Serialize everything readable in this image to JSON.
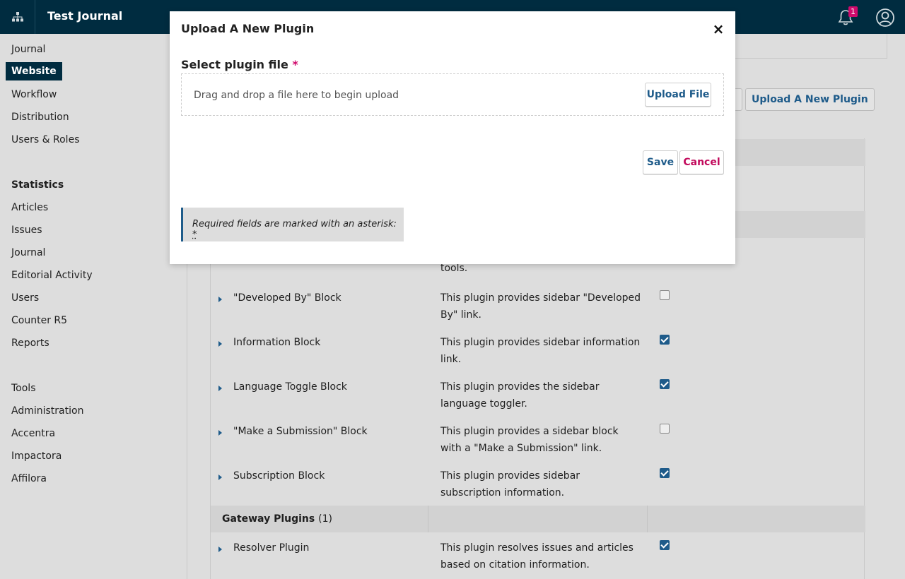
{
  "header": {
    "title": "Test Journal",
    "notification_count": "1",
    "brand_color": "#002c40",
    "accent_color": "#1e5b8a",
    "alert_color": "#d00a6c"
  },
  "sidebar": {
    "items": [
      {
        "label": "Journal"
      },
      {
        "label": "Website"
      },
      {
        "label": "Workflow"
      },
      {
        "label": "Distribution"
      },
      {
        "label": "Users & Roles"
      }
    ],
    "statistics_heading": "Statistics",
    "statistics_items": [
      {
        "label": "Articles"
      },
      {
        "label": "Issues"
      },
      {
        "label": "Journal"
      },
      {
        "label": "Editorial Activity"
      },
      {
        "label": "Users"
      },
      {
        "label": "Counter R5"
      },
      {
        "label": "Reports"
      }
    ],
    "tools_items": [
      {
        "label": "Tools"
      },
      {
        "label": "Administration"
      },
      {
        "label": "Accentra"
      },
      {
        "label": "Impactora"
      },
      {
        "label": "Affilora"
      }
    ]
  },
  "main": {
    "upload_button_label": "Upload A New Plugin",
    "partial_desc": "tools.",
    "plugins": [
      {
        "name": "\"Developed By\" Block",
        "desc": "This plugin provides sidebar \"Developed By\" link.",
        "enabled": false
      },
      {
        "name": "Information Block",
        "desc": "This plugin provides sidebar information link.",
        "enabled": true
      },
      {
        "name": "Language Toggle Block",
        "desc": "This plugin provides the sidebar language toggler.",
        "enabled": true
      },
      {
        "name": "\"Make a Submission\" Block",
        "desc": "This plugin provides a sidebar block with a \"Make a Submission\" link.",
        "enabled": false
      },
      {
        "name": "Subscription Block",
        "desc": "This plugin provides sidebar subscription information.",
        "enabled": true
      }
    ],
    "gateway_group": {
      "name": "Gateway Plugins",
      "count": "(1)"
    },
    "gateway_plugins": [
      {
        "name": "Resolver Plugin",
        "desc": "This plugin resolves issues and articles based on citation information.",
        "enabled": true
      }
    ]
  },
  "modal": {
    "title": "Upload A New Plugin",
    "close_symbol": "×",
    "field_label": "Select plugin file",
    "required_marker": "*",
    "dropzone_text": "Drag and drop a file here to begin upload",
    "upload_file_label": "Upload File",
    "save_label": "Save",
    "cancel_label": "Cancel",
    "notice_text": "Required fields are marked with an asterisk: ",
    "notice_asterisk": "*"
  }
}
